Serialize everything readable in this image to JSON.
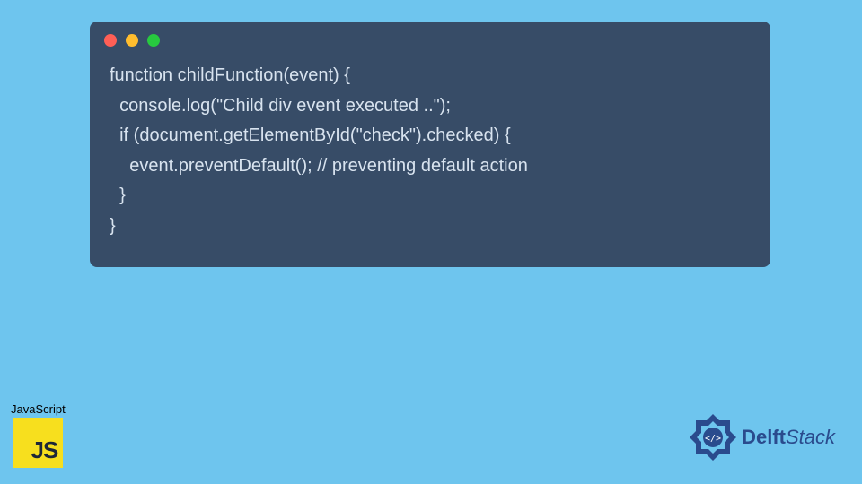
{
  "code": {
    "line1": "function childFunction(event) {",
    "line2": "  console.log(\"Child div event executed ..\");",
    "line3": "  if (document.getElementById(\"check\").checked) {",
    "line4": "    event.preventDefault(); // preventing default action",
    "line5": "  }",
    "line6": "}"
  },
  "jsBadge": {
    "label": "JavaScript",
    "logoText": "JS"
  },
  "delftBadge": {
    "textPrefix": "Delft",
    "textSuffix": "Stack"
  },
  "colors": {
    "background": "#6ec5ee",
    "codeBg": "#374c67",
    "codeText": "#d8e3ef",
    "jsYellow": "#f7df1e",
    "delftBlue": "#2a4b8d"
  }
}
